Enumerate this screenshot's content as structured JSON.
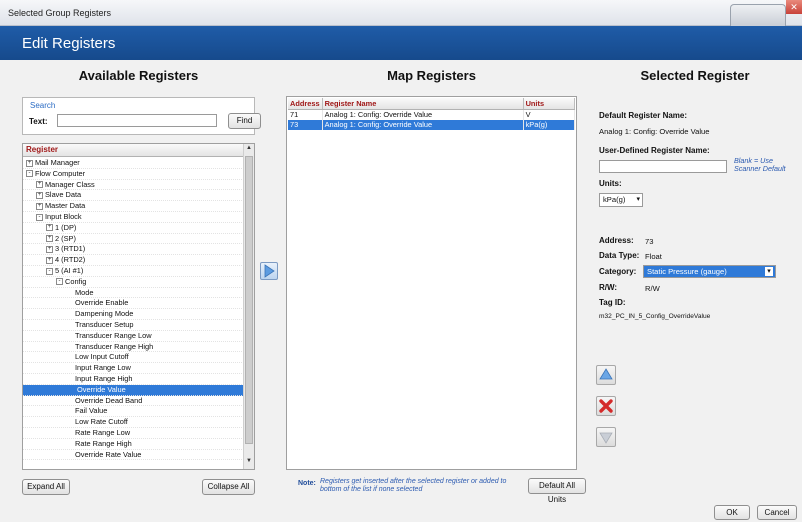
{
  "window": {
    "title": "Selected Group Registers"
  },
  "header": {
    "title": "Edit Registers"
  },
  "columns": {
    "available": "Available Registers",
    "map": "Map Registers",
    "selected": "Selected Register"
  },
  "search": {
    "group_label": "Search",
    "text_label": "Text:",
    "value": "",
    "find_label": "Find"
  },
  "tree": {
    "header": "Register",
    "rows": [
      {
        "label": "Mail Manager",
        "indent": 0,
        "exp": "+"
      },
      {
        "label": "Flow Computer",
        "indent": 0,
        "exp": "-"
      },
      {
        "label": "Manager Class",
        "indent": 1,
        "exp": "+"
      },
      {
        "label": "Slave Data",
        "indent": 1,
        "exp": "+"
      },
      {
        "label": "Master Data",
        "indent": 1,
        "exp": "+"
      },
      {
        "label": "Input Block",
        "indent": 1,
        "exp": "-"
      },
      {
        "label": "1 (DP)",
        "indent": 2,
        "exp": "+"
      },
      {
        "label": "2 (SP)",
        "indent": 2,
        "exp": "+"
      },
      {
        "label": "3 (RTD1)",
        "indent": 2,
        "exp": "+"
      },
      {
        "label": "4 (RTD2)",
        "indent": 2,
        "exp": "+"
      },
      {
        "label": "5 (AI #1)",
        "indent": 2,
        "exp": "-"
      },
      {
        "label": "Config",
        "indent": 3,
        "exp": "-"
      },
      {
        "label": "Mode",
        "indent": 4,
        "exp": ""
      },
      {
        "label": "Override Enable",
        "indent": 4,
        "exp": ""
      },
      {
        "label": "Dampening Mode",
        "indent": 4,
        "exp": ""
      },
      {
        "label": "Transducer Setup",
        "indent": 4,
        "exp": ""
      },
      {
        "label": "Transducer Range Low",
        "indent": 4,
        "exp": ""
      },
      {
        "label": "Transducer Range High",
        "indent": 4,
        "exp": ""
      },
      {
        "label": "Low Input Cutoff",
        "indent": 4,
        "exp": ""
      },
      {
        "label": "Input Range Low",
        "indent": 4,
        "exp": ""
      },
      {
        "label": "Input Range High",
        "indent": 4,
        "exp": ""
      },
      {
        "label": "Override Value",
        "indent": 4,
        "exp": "",
        "selected": true
      },
      {
        "label": "Override Dead Band",
        "indent": 4,
        "exp": ""
      },
      {
        "label": "Fail Value",
        "indent": 4,
        "exp": ""
      },
      {
        "label": "Low Rate Cutoff",
        "indent": 4,
        "exp": ""
      },
      {
        "label": "Rate Range Low",
        "indent": 4,
        "exp": ""
      },
      {
        "label": "Rate Range High",
        "indent": 4,
        "exp": ""
      },
      {
        "label": "Override Rate Value",
        "indent": 4,
        "exp": ""
      }
    ]
  },
  "buttons": {
    "expand_all": "Expand All",
    "collapse_all": "Collapse All",
    "default_all_units": "Default All Units",
    "ok": "OK",
    "cancel": "Cancel"
  },
  "map_table": {
    "headers": [
      "Address",
      "Register Name",
      "Units"
    ],
    "rows": [
      {
        "address": "71",
        "name": "Analog 1: Config: Override Value",
        "units": "V",
        "selected": false
      },
      {
        "address": "73",
        "name": "Analog 1: Config: Override Value",
        "units": "kPa(g)",
        "selected": true
      }
    ]
  },
  "note": {
    "label": "Note:",
    "text": "Registers get inserted after the selected register or added to bottom of the list if none selected"
  },
  "selected_register": {
    "default_name_label": "Default Register Name:",
    "default_name_value": "Analog 1: Config: Override Value",
    "user_defined_label": "User-Defined Register Name:",
    "user_defined_value": "",
    "hint": "Blank = Use Scanner Default",
    "units_label": "Units:",
    "units_value": "kPa(g)",
    "address_label": "Address:",
    "address_value": "73",
    "data_type_label": "Data Type:",
    "data_type_value": "Float",
    "category_label": "Category:",
    "category_value": "Static Pressure (gauge)",
    "rw_label": "R/W:",
    "rw_value": "R/W",
    "tag_label": "Tag ID:",
    "tag_value": "m32_PC_IN_5_Config_OverrideValue"
  },
  "colors": {
    "header_blue": "#1f5ca8",
    "selection_blue": "#2f7ad8",
    "column_header_red": "#a01818",
    "delete_red": "#d42a2a"
  }
}
